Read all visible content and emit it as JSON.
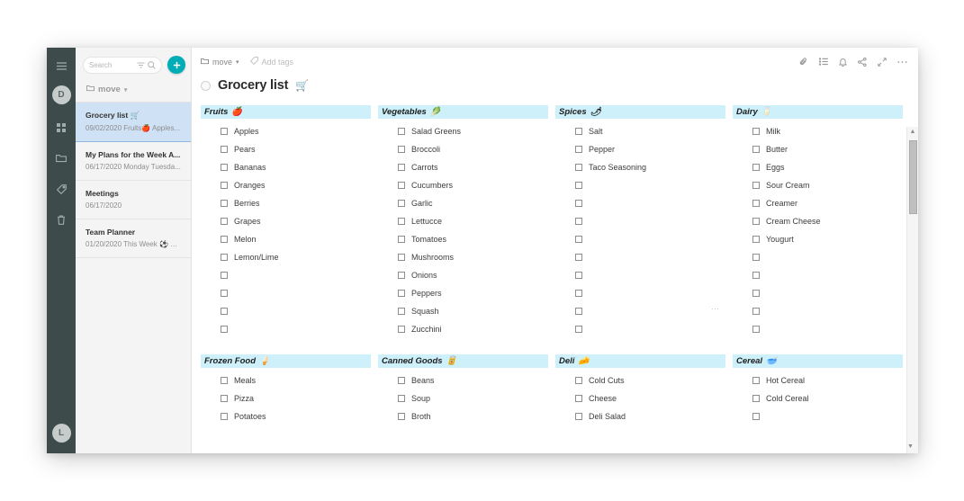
{
  "rail": {
    "menu_icon": "hamburger-icon",
    "avatar_top": "D",
    "items": [
      "dashboard-icon",
      "folder-icon",
      "tag-icon",
      "trash-icon"
    ],
    "avatar_bottom": "L"
  },
  "sidebar": {
    "search": {
      "placeholder": "Search",
      "filter_icon": "filter-icon",
      "search_icon": "search-icon"
    },
    "add_button": "+",
    "folder": {
      "label": "move",
      "icon": "folder-icon",
      "caret": "▾"
    },
    "notes": [
      {
        "title": "Grocery list 🛒",
        "snippet": "09/02/2020 Fruits🍎 Apples...",
        "active": true
      },
      {
        "title": "My Plans for the Week A...",
        "snippet": "06/17/2020 Monday Tuesda...",
        "active": false
      },
      {
        "title": "Meetings",
        "snippet": "06/17/2020",
        "active": false
      },
      {
        "title": "Team Planner",
        "snippet": "01/20/2020 This Week ⚽ G...",
        "active": false
      }
    ]
  },
  "editor": {
    "breadcrumb": {
      "icon": "folder-icon",
      "label": "move",
      "caret": "▾"
    },
    "tags": {
      "icon": "tag-icon",
      "label": "Add tags"
    },
    "top_icons": [
      "attachment-icon",
      "checklist-icon",
      "bell-icon",
      "share-icon",
      "expand-icon",
      "more-icon"
    ],
    "note": {
      "bullet": "radio-dot",
      "title": "Grocery list",
      "emoji": "🛒"
    },
    "handle_dots": "⋯",
    "scrollbar": {
      "up": "▲",
      "down": "▼"
    }
  },
  "columns": [
    {
      "title": "Fruits",
      "emoji": "🍎",
      "items": [
        "Apples",
        "Pears",
        "Bananas",
        "Oranges",
        "Berries",
        "Grapes",
        "Melon",
        "Lemon/Lime",
        "",
        "",
        "",
        ""
      ]
    },
    {
      "title": "Vegetables",
      "emoji": "🥬",
      "items": [
        "Salad Greens",
        "Broccoli",
        "Carrots",
        "Cucumbers",
        "Garlic",
        "Lettucce",
        "Tomatoes",
        "Mushrooms",
        "Onions",
        "Peppers",
        "Squash",
        "Zucchini"
      ]
    },
    {
      "title": "Spices",
      "emoji": "🌶",
      "items": [
        "Salt",
        "Pepper",
        "Taco Seasoning",
        "",
        "",
        "",
        "",
        "",
        "",
        "",
        "",
        ""
      ]
    },
    {
      "title": "Dairy",
      "emoji": "🥛",
      "items": [
        "Milk",
        "Butter",
        "Eggs",
        "Sour Cream",
        "Creamer",
        "Cream Cheese",
        "Yougurt",
        "",
        "",
        "",
        "",
        ""
      ]
    },
    {
      "title": "Frozen Food",
      "emoji": "🍦",
      "items": [
        "Meals",
        "Pizza",
        "Potatoes"
      ]
    },
    {
      "title": "Canned Goods",
      "emoji": "🥫",
      "items": [
        "Beans",
        "Soup",
        "Broth"
      ]
    },
    {
      "title": "Deli",
      "emoji": "🧀",
      "items": [
        "Cold Cuts",
        "Cheese",
        "Deli Salad"
      ]
    },
    {
      "title": "Cereal",
      "emoji": "🥣",
      "items": [
        "Hot Cereal",
        "Cold Cereal",
        ""
      ]
    }
  ],
  "colors": {
    "rail": "#3e4b4b",
    "accent": "#00acb6",
    "column_header": "#cdf0fb",
    "active_note": "#cfe1f5"
  }
}
